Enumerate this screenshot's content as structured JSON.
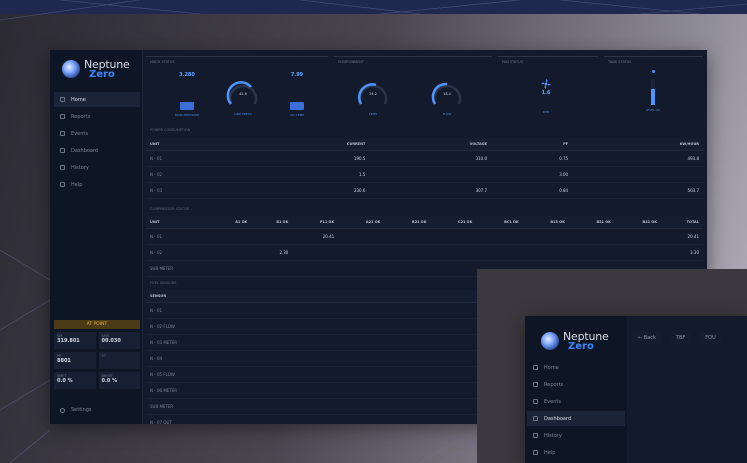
{
  "brand": {
    "name_top": "Neptune",
    "name_bottom": "Zero"
  },
  "main_window": {
    "sidebar": {
      "items": [
        {
          "label": "Home",
          "active": true
        },
        {
          "label": "Reports",
          "active": false
        },
        {
          "label": "Events",
          "active": false
        },
        {
          "label": "Dashboard",
          "active": false
        },
        {
          "label": "History",
          "active": false
        },
        {
          "label": "Help",
          "active": false
        }
      ],
      "status_title": "AT POINT",
      "status_cells": [
        {
          "label": "SM",
          "value": "319.801"
        },
        {
          "label": "SMS",
          "value": "00.030"
        },
        {
          "label": "PP",
          "value": "8801"
        },
        {
          "label": "VT",
          "value": ""
        },
        {
          "label": "SMFT",
          "value": "0.0 %"
        },
        {
          "label": "BNFRT",
          "value": "0.0 %"
        }
      ],
      "settings_label": "Settings"
    },
    "panels": [
      {
        "label": "MACH STATUS"
      },
      {
        "label": "ENVIRONMENT"
      },
      {
        "label": "FAN STATUS"
      },
      {
        "label": "TANK STATUS"
      }
    ],
    "stats": [
      {
        "value": "3.280",
        "caption": "TANK PRESSURE"
      },
      {
        "value": "7.99",
        "caption": "OIL TEMP"
      }
    ],
    "gauges": [
      {
        "value": "42.6",
        "caption": "LINE PRESS",
        "level": 0.55
      },
      {
        "value": "24.2",
        "caption": "TEMP",
        "level": 0.45
      },
      {
        "value": "18.4",
        "caption": "FLOW",
        "level": 0.4
      }
    ],
    "fan": {
      "value": "1.6",
      "caption": "RPM"
    },
    "tank": {
      "caption": "LEVEL OK"
    },
    "table1": {
      "label": "POWER CONSUMPTION",
      "headers": [
        "UNIT",
        "CURRENT",
        "VOLTAGE",
        "PF",
        "KW/HOUR"
      ],
      "rows": [
        [
          "N - 01",
          "190.5",
          "310.0",
          "0.75",
          "493.8"
        ],
        [
          "N - 02",
          "1.5",
          "",
          "3.00",
          ""
        ],
        [
          "N - 03",
          "230.6",
          "307.7",
          "0.84",
          "503.7"
        ]
      ]
    },
    "table2": {
      "label": "COMPRESSOR STATUS",
      "headers": [
        "UNIT",
        "A1 OK",
        "B1 OK",
        "P11 OK",
        "A21 OK",
        "B21 OK",
        "C21 OK",
        "BC1 OK",
        "B13 OK",
        "B51 OK",
        "B41 OK",
        "TOTAL"
      ],
      "rows": [
        [
          "N - 01",
          "",
          "",
          "20.41",
          "",
          "",
          "",
          "",
          "",
          "",
          "",
          "20.41"
        ],
        [
          "N - 02",
          "",
          "2.30",
          "",
          "",
          "",
          "",
          "",
          "",
          "",
          "",
          "3.30"
        ],
        [
          "SUB METER",
          "",
          "",
          "",
          "",
          "",
          "",
          "",
          "",
          "",
          "",
          ""
        ]
      ]
    },
    "table3": {
      "label": "FUEL SENSORS",
      "headers": [
        "SENSOR",
        "",
        "",
        "VALUE"
      ],
      "rows": [
        [
          "N - 01",
          "",
          "",
          "1,070.1"
        ],
        [
          "N - 02 FLOW",
          "",
          "",
          "1,790.6"
        ],
        [
          "N - 03 METER",
          "",
          "",
          "193.3"
        ],
        [
          "N - 04",
          "",
          "",
          "180.5"
        ],
        [
          "N - 05 FLOW",
          "",
          "",
          "4,030.8"
        ],
        [
          "N - 06 METER",
          "",
          "",
          "5,770.6"
        ],
        [
          "SUB METER",
          "",
          "",
          "-"
        ],
        [
          "N - 07 OUT",
          "",
          "",
          "111.8"
        ]
      ]
    }
  },
  "front_window": {
    "toolbar": [
      {
        "label": "← Back"
      },
      {
        "label": "TBF"
      },
      {
        "label": "FOU"
      }
    ],
    "sidebar": {
      "items": [
        {
          "label": "Home",
          "active": false
        },
        {
          "label": "Reports",
          "active": false
        },
        {
          "label": "Events",
          "active": false
        },
        {
          "label": "Dashboard",
          "active": true
        },
        {
          "label": "History",
          "active": false
        },
        {
          "label": "Help",
          "active": false
        }
      ]
    }
  }
}
